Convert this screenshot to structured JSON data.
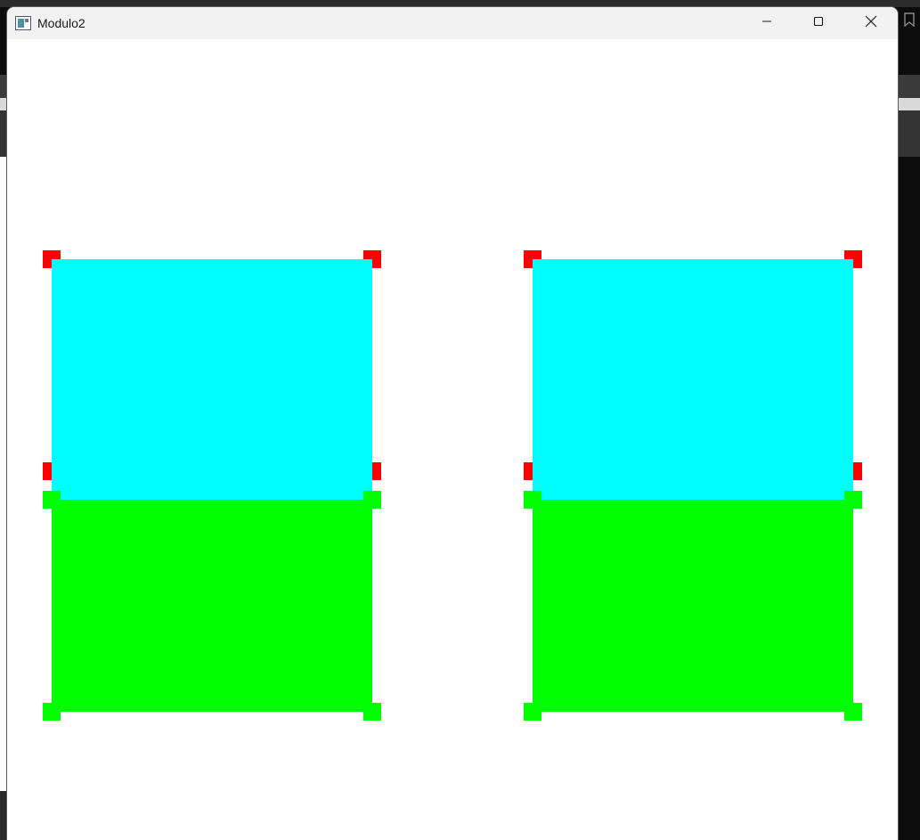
{
  "window": {
    "title": "Modulo2",
    "app_icon": "window-app-icon",
    "controls": {
      "minimize_icon": "minimize-icon",
      "maximize_icon": "maximize-icon",
      "close_icon": "close-icon"
    }
  },
  "colors": {
    "top_rect": "#00ffff",
    "bottom_rect": "#00ff00",
    "top_handles": "#ff0000",
    "bottom_handles": "#00ff00",
    "canvas_background": "#ffffff",
    "titlebar_background": "#f2f2f2"
  }
}
